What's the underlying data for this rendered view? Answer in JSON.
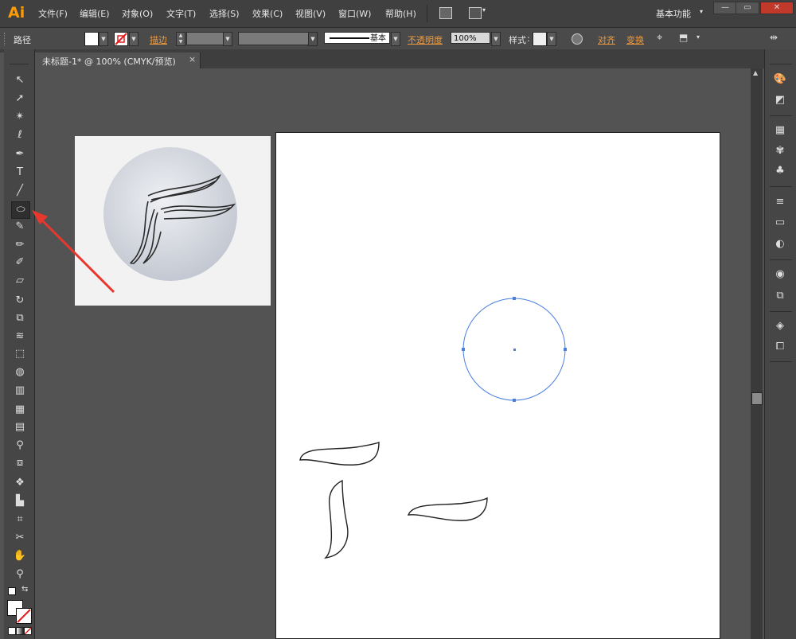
{
  "app": {
    "logo": "Ai",
    "workspace": "基本功能",
    "workspace_arrow": "▾"
  },
  "menu": {
    "items": [
      "文件(F)",
      "编辑(E)",
      "对象(O)",
      "文字(T)",
      "选择(S)",
      "效果(C)",
      "视图(V)",
      "窗口(W)",
      "帮助(H)"
    ]
  },
  "window_controls": {
    "minimize": "—",
    "maximize": "▭",
    "close": "✕"
  },
  "control_bar": {
    "selection_label": "路径",
    "stroke_label": "描边",
    "stroke_profile": "基本",
    "opacity_label": "不透明度",
    "opacity_value": "100%",
    "style_label": "样式",
    "align_label": "对齐",
    "transform_label": "变换"
  },
  "document": {
    "tab_title": "未标题-1* @ 100% (CMYK/预览)",
    "tab_close": "×"
  },
  "colors": {
    "accent_orange": "#f09a3e",
    "selection_blue": "#4a7fe0",
    "annotation_red": "#e8372d"
  },
  "tools": [
    {
      "name": "selection-tool-icon",
      "glyph": "↖"
    },
    {
      "name": "direct-selection-tool-icon",
      "glyph": "➚"
    },
    {
      "name": "magic-wand-tool-icon",
      "glyph": "✴"
    },
    {
      "name": "lasso-tool-icon",
      "glyph": "ℓ"
    },
    {
      "name": "pen-tool-icon",
      "glyph": "✒"
    },
    {
      "name": "type-tool-icon",
      "glyph": "T"
    },
    {
      "name": "line-tool-icon",
      "glyph": "╱"
    },
    {
      "name": "ellipse-tool-icon",
      "glyph": "⬭"
    },
    {
      "name": "paintbrush-tool-icon",
      "glyph": "✎"
    },
    {
      "name": "pencil-tool-icon",
      "glyph": "✏"
    },
    {
      "name": "blob-brush-tool-icon",
      "glyph": "✐"
    },
    {
      "name": "eraser-tool-icon",
      "glyph": "▱"
    },
    {
      "name": "rotate-tool-icon",
      "glyph": "↻"
    },
    {
      "name": "scale-tool-icon",
      "glyph": "⧉"
    },
    {
      "name": "width-tool-icon",
      "glyph": "≋"
    },
    {
      "name": "free-transform-tool-icon",
      "glyph": "⬚"
    },
    {
      "name": "shape-builder-tool-icon",
      "glyph": "◍"
    },
    {
      "name": "perspective-grid-tool-icon",
      "glyph": "▥"
    },
    {
      "name": "mesh-tool-icon",
      "glyph": "▦"
    },
    {
      "name": "gradient-tool-icon",
      "glyph": "▤"
    },
    {
      "name": "eyedropper-tool-icon",
      "glyph": "⚲"
    },
    {
      "name": "blend-tool-icon",
      "glyph": "⧈"
    },
    {
      "name": "symbol-sprayer-tool-icon",
      "glyph": "❖"
    },
    {
      "name": "column-graph-tool-icon",
      "glyph": "▙"
    },
    {
      "name": "artboard-tool-icon",
      "glyph": "⌗"
    },
    {
      "name": "slice-tool-icon",
      "glyph": "✂"
    },
    {
      "name": "hand-tool-icon",
      "glyph": "✋"
    },
    {
      "name": "zoom-tool-icon",
      "glyph": "⚲"
    }
  ],
  "dock": [
    {
      "name": "color-panel-icon",
      "glyph": "🎨"
    },
    {
      "name": "color-guide-icon",
      "glyph": "◩"
    },
    {
      "name": "swatches-panel-icon",
      "glyph": "▦"
    },
    {
      "name": "brushes-panel-icon",
      "glyph": "✾"
    },
    {
      "name": "symbols-panel-icon",
      "glyph": "♣"
    },
    {
      "name": "stroke-panel-icon",
      "glyph": "≡"
    },
    {
      "name": "gradient-panel-icon",
      "glyph": "▭"
    },
    {
      "name": "transparency-panel-icon",
      "glyph": "◐"
    },
    {
      "name": "appearance-panel-icon",
      "glyph": "◉"
    },
    {
      "name": "graphic-styles-panel-icon",
      "glyph": "⧉"
    },
    {
      "name": "layers-panel-icon",
      "glyph": "◈"
    },
    {
      "name": "artboards-panel-icon",
      "glyph": "⧠"
    }
  ]
}
